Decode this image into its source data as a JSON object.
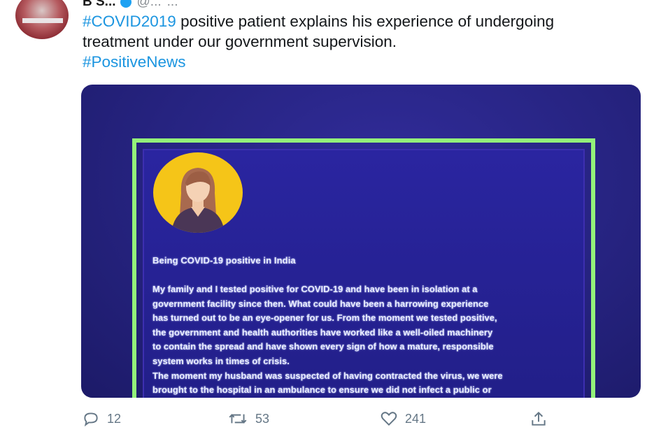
{
  "tweet": {
    "author_name": "B S...",
    "author_handle": "@...",
    "more": "...",
    "text_line1_hashtag": "#COVID2019",
    "text_line1_rest": " positive patient explains his experience of undergoing",
    "text_line2": "treatment under our government supervision.",
    "text_line3_hashtag": "#PositiveNews"
  },
  "media_card": {
    "heading": "Being COVID-19 positive in India",
    "body_lines": [
      "My family and I tested positive for COVID-19 and have been in isolation at a",
      "government facility since then. What could have been a harrowing experience",
      "has turned out to be an eye-opener for us. From the moment we tested positive,",
      "the government and health authorities have worked like a well-oiled machinery",
      "to contain the spread and have shown every sign of how a mature, responsible",
      "system works in times of crisis.",
      "The moment my husband was suspected of having contracted the virus, we were",
      "brought to the hospital in an ambulance to ensure we did not infect a public or"
    ]
  },
  "actions": {
    "reply_count": "12",
    "retweet_count": "53",
    "like_count": "241",
    "reply_icon": "reply-icon",
    "retweet_icon": "retweet-icon",
    "like_icon": "heart-icon",
    "share_icon": "share-icon"
  },
  "colors": {
    "hashtag": "#1b95e0",
    "card_background": "#262380",
    "card_border": "#93f27a",
    "avatar_circle": "#f5c518"
  }
}
